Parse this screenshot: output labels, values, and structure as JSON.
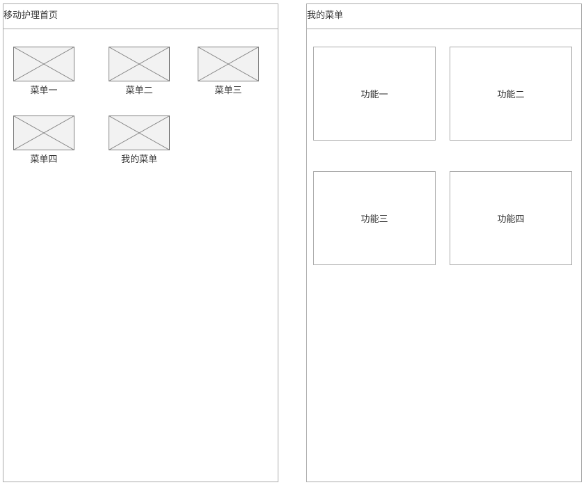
{
  "home": {
    "title": "移动护理首页",
    "menu_items": [
      {
        "label": "菜单一",
        "icon": "image-placeholder-icon"
      },
      {
        "label": "菜单二",
        "icon": "image-placeholder-icon"
      },
      {
        "label": "菜单三",
        "icon": "image-placeholder-icon"
      },
      {
        "label": "菜单四",
        "icon": "image-placeholder-icon"
      },
      {
        "label": "我的菜单",
        "icon": "image-placeholder-icon"
      }
    ]
  },
  "my_menu": {
    "title": "我的菜单",
    "functions": [
      {
        "label": "功能一"
      },
      {
        "label": "功能二"
      },
      {
        "label": "功能三"
      },
      {
        "label": "功能四"
      }
    ]
  },
  "colors": {
    "border": "#aaaaaa",
    "placeholder_fill": "#f2f2f2",
    "placeholder_stroke": "#7f7f7f",
    "text": "#333333"
  }
}
